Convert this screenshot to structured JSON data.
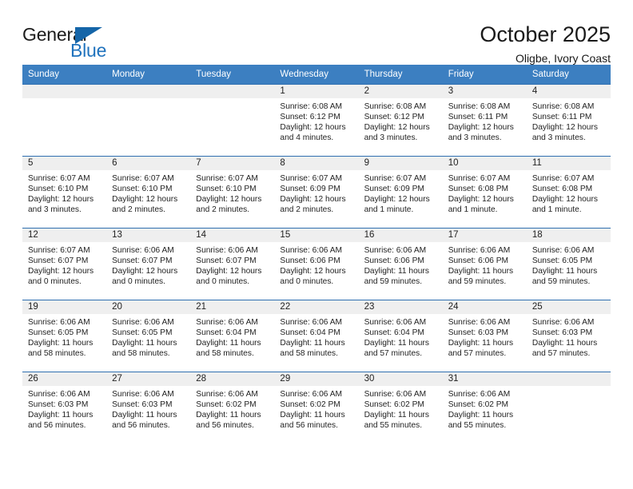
{
  "brand": {
    "name_top": "General",
    "name_bottom": "Blue",
    "triangle_color": "#1565a8",
    "blue_text_color": "#1f72bd"
  },
  "header": {
    "title": "October 2025",
    "subtitle": "Oligbe, Ivory Coast"
  },
  "theme": {
    "header_row_bg": "#3c7fc1",
    "row_divider": "#2f6fb0",
    "daynum_band_bg": "#efefef",
    "text": "#222222"
  },
  "weekday_headers": [
    "Sunday",
    "Monday",
    "Tuesday",
    "Wednesday",
    "Thursday",
    "Friday",
    "Saturday"
  ],
  "labels": {
    "sunrise_prefix": "Sunrise:",
    "sunset_prefix": "Sunset:",
    "daylight_prefix": "Daylight:"
  },
  "weeks": [
    [
      {
        "day": "",
        "sunrise": "",
        "sunset": "",
        "daylight_line1": "",
        "daylight_line2": ""
      },
      {
        "day": "",
        "sunrise": "",
        "sunset": "",
        "daylight_line1": "",
        "daylight_line2": ""
      },
      {
        "day": "",
        "sunrise": "",
        "sunset": "",
        "daylight_line1": "",
        "daylight_line2": ""
      },
      {
        "day": "1",
        "sunrise": "Sunrise: 6:08 AM",
        "sunset": "Sunset: 6:12 PM",
        "daylight_line1": "Daylight: 12 hours",
        "daylight_line2": "and 4 minutes."
      },
      {
        "day": "2",
        "sunrise": "Sunrise: 6:08 AM",
        "sunset": "Sunset: 6:12 PM",
        "daylight_line1": "Daylight: 12 hours",
        "daylight_line2": "and 3 minutes."
      },
      {
        "day": "3",
        "sunrise": "Sunrise: 6:08 AM",
        "sunset": "Sunset: 6:11 PM",
        "daylight_line1": "Daylight: 12 hours",
        "daylight_line2": "and 3 minutes."
      },
      {
        "day": "4",
        "sunrise": "Sunrise: 6:08 AM",
        "sunset": "Sunset: 6:11 PM",
        "daylight_line1": "Daylight: 12 hours",
        "daylight_line2": "and 3 minutes."
      }
    ],
    [
      {
        "day": "5",
        "sunrise": "Sunrise: 6:07 AM",
        "sunset": "Sunset: 6:10 PM",
        "daylight_line1": "Daylight: 12 hours",
        "daylight_line2": "and 3 minutes."
      },
      {
        "day": "6",
        "sunrise": "Sunrise: 6:07 AM",
        "sunset": "Sunset: 6:10 PM",
        "daylight_line1": "Daylight: 12 hours",
        "daylight_line2": "and 2 minutes."
      },
      {
        "day": "7",
        "sunrise": "Sunrise: 6:07 AM",
        "sunset": "Sunset: 6:10 PM",
        "daylight_line1": "Daylight: 12 hours",
        "daylight_line2": "and 2 minutes."
      },
      {
        "day": "8",
        "sunrise": "Sunrise: 6:07 AM",
        "sunset": "Sunset: 6:09 PM",
        "daylight_line1": "Daylight: 12 hours",
        "daylight_line2": "and 2 minutes."
      },
      {
        "day": "9",
        "sunrise": "Sunrise: 6:07 AM",
        "sunset": "Sunset: 6:09 PM",
        "daylight_line1": "Daylight: 12 hours",
        "daylight_line2": "and 1 minute."
      },
      {
        "day": "10",
        "sunrise": "Sunrise: 6:07 AM",
        "sunset": "Sunset: 6:08 PM",
        "daylight_line1": "Daylight: 12 hours",
        "daylight_line2": "and 1 minute."
      },
      {
        "day": "11",
        "sunrise": "Sunrise: 6:07 AM",
        "sunset": "Sunset: 6:08 PM",
        "daylight_line1": "Daylight: 12 hours",
        "daylight_line2": "and 1 minute."
      }
    ],
    [
      {
        "day": "12",
        "sunrise": "Sunrise: 6:07 AM",
        "sunset": "Sunset: 6:07 PM",
        "daylight_line1": "Daylight: 12 hours",
        "daylight_line2": "and 0 minutes."
      },
      {
        "day": "13",
        "sunrise": "Sunrise: 6:06 AM",
        "sunset": "Sunset: 6:07 PM",
        "daylight_line1": "Daylight: 12 hours",
        "daylight_line2": "and 0 minutes."
      },
      {
        "day": "14",
        "sunrise": "Sunrise: 6:06 AM",
        "sunset": "Sunset: 6:07 PM",
        "daylight_line1": "Daylight: 12 hours",
        "daylight_line2": "and 0 minutes."
      },
      {
        "day": "15",
        "sunrise": "Sunrise: 6:06 AM",
        "sunset": "Sunset: 6:06 PM",
        "daylight_line1": "Daylight: 12 hours",
        "daylight_line2": "and 0 minutes."
      },
      {
        "day": "16",
        "sunrise": "Sunrise: 6:06 AM",
        "sunset": "Sunset: 6:06 PM",
        "daylight_line1": "Daylight: 11 hours",
        "daylight_line2": "and 59 minutes."
      },
      {
        "day": "17",
        "sunrise": "Sunrise: 6:06 AM",
        "sunset": "Sunset: 6:06 PM",
        "daylight_line1": "Daylight: 11 hours",
        "daylight_line2": "and 59 minutes."
      },
      {
        "day": "18",
        "sunrise": "Sunrise: 6:06 AM",
        "sunset": "Sunset: 6:05 PM",
        "daylight_line1": "Daylight: 11 hours",
        "daylight_line2": "and 59 minutes."
      }
    ],
    [
      {
        "day": "19",
        "sunrise": "Sunrise: 6:06 AM",
        "sunset": "Sunset: 6:05 PM",
        "daylight_line1": "Daylight: 11 hours",
        "daylight_line2": "and 58 minutes."
      },
      {
        "day": "20",
        "sunrise": "Sunrise: 6:06 AM",
        "sunset": "Sunset: 6:05 PM",
        "daylight_line1": "Daylight: 11 hours",
        "daylight_line2": "and 58 minutes."
      },
      {
        "day": "21",
        "sunrise": "Sunrise: 6:06 AM",
        "sunset": "Sunset: 6:04 PM",
        "daylight_line1": "Daylight: 11 hours",
        "daylight_line2": "and 58 minutes."
      },
      {
        "day": "22",
        "sunrise": "Sunrise: 6:06 AM",
        "sunset": "Sunset: 6:04 PM",
        "daylight_line1": "Daylight: 11 hours",
        "daylight_line2": "and 58 minutes."
      },
      {
        "day": "23",
        "sunrise": "Sunrise: 6:06 AM",
        "sunset": "Sunset: 6:04 PM",
        "daylight_line1": "Daylight: 11 hours",
        "daylight_line2": "and 57 minutes."
      },
      {
        "day": "24",
        "sunrise": "Sunrise: 6:06 AM",
        "sunset": "Sunset: 6:03 PM",
        "daylight_line1": "Daylight: 11 hours",
        "daylight_line2": "and 57 minutes."
      },
      {
        "day": "25",
        "sunrise": "Sunrise: 6:06 AM",
        "sunset": "Sunset: 6:03 PM",
        "daylight_line1": "Daylight: 11 hours",
        "daylight_line2": "and 57 minutes."
      }
    ],
    [
      {
        "day": "26",
        "sunrise": "Sunrise: 6:06 AM",
        "sunset": "Sunset: 6:03 PM",
        "daylight_line1": "Daylight: 11 hours",
        "daylight_line2": "and 56 minutes."
      },
      {
        "day": "27",
        "sunrise": "Sunrise: 6:06 AM",
        "sunset": "Sunset: 6:03 PM",
        "daylight_line1": "Daylight: 11 hours",
        "daylight_line2": "and 56 minutes."
      },
      {
        "day": "28",
        "sunrise": "Sunrise: 6:06 AM",
        "sunset": "Sunset: 6:02 PM",
        "daylight_line1": "Daylight: 11 hours",
        "daylight_line2": "and 56 minutes."
      },
      {
        "day": "29",
        "sunrise": "Sunrise: 6:06 AM",
        "sunset": "Sunset: 6:02 PM",
        "daylight_line1": "Daylight: 11 hours",
        "daylight_line2": "and 56 minutes."
      },
      {
        "day": "30",
        "sunrise": "Sunrise: 6:06 AM",
        "sunset": "Sunset: 6:02 PM",
        "daylight_line1": "Daylight: 11 hours",
        "daylight_line2": "and 55 minutes."
      },
      {
        "day": "31",
        "sunrise": "Sunrise: 6:06 AM",
        "sunset": "Sunset: 6:02 PM",
        "daylight_line1": "Daylight: 11 hours",
        "daylight_line2": "and 55 minutes."
      },
      {
        "day": "",
        "sunrise": "",
        "sunset": "",
        "daylight_line1": "",
        "daylight_line2": ""
      }
    ]
  ]
}
